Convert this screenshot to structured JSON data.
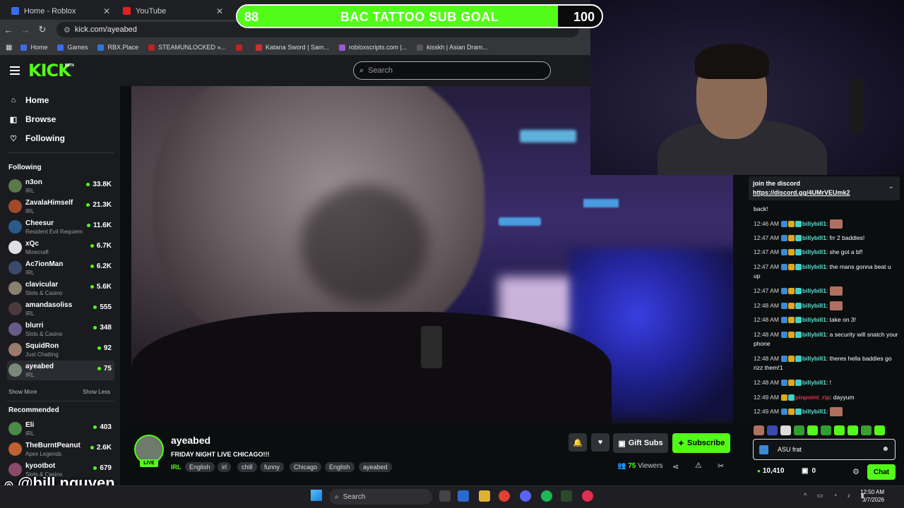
{
  "browser": {
    "tabs": [
      {
        "title": "Home - Roblox",
        "color": "#3b6ce8",
        "active": false
      },
      {
        "title": "YouTube",
        "color": "#e02020",
        "active": false
      }
    ],
    "url": "kick.com/ayeabed",
    "bookmarks": [
      {
        "label": "Home",
        "color": "#3b6ce8"
      },
      {
        "label": "Games",
        "color": "#3b6ce8"
      },
      {
        "label": "RBX.Place",
        "color": "#2a7ae0"
      },
      {
        "label": "STEAMUNLOCKED »...",
        "color": "#c02020"
      },
      {
        "label": "",
        "color": "#c02020"
      },
      {
        "label": "Katana Sword | Sam...",
        "color": "#d03030"
      },
      {
        "label": "robloxscripts.com |...",
        "color": "#9a5ad0"
      },
      {
        "label": "kisskh | Asian Dram...",
        "color": "#555"
      }
    ]
  },
  "sub_goal": {
    "current": "88",
    "target": "100",
    "title": "BAC TATTOO SUB GOAL",
    "progress": 0.88
  },
  "kick": {
    "logo": "KICK",
    "beta": "BETA",
    "search_placeholder": "Search"
  },
  "sidebar": {
    "nav": [
      {
        "label": "Home",
        "icon": "home-icon",
        "glyph": "⌂"
      },
      {
        "label": "Browse",
        "icon": "browse-icon",
        "glyph": "◧"
      },
      {
        "label": "Following",
        "icon": "heart-icon",
        "glyph": "♡"
      }
    ],
    "following_title": "Following",
    "following": [
      {
        "name": "n3on",
        "category": "IRL",
        "viewers": "33.8K",
        "color": "#5a7a4a"
      },
      {
        "name": "ZavalaHimself",
        "category": "IRL",
        "viewers": "21.3K",
        "color": "#a04a2a"
      },
      {
        "name": "Cheesur",
        "category": "Resident Evil Requiem",
        "viewers": "11.6K",
        "color": "#2a5a8a"
      },
      {
        "name": "xQc",
        "category": "Minecraft",
        "viewers": "6.7K",
        "color": "#e0e0e0"
      },
      {
        "name": "Ac7ionMan",
        "category": "IRL",
        "viewers": "6.2K",
        "color": "#3a4a6a"
      },
      {
        "name": "clavicular",
        "category": "Slots & Casino",
        "viewers": "5.6K",
        "color": "#8a8070"
      },
      {
        "name": "amandasoliss",
        "category": "IRL",
        "viewers": "555",
        "color": "#4a3a3a"
      },
      {
        "name": "blurri",
        "category": "Slots & Casino",
        "viewers": "348",
        "color": "#6a5a8a"
      },
      {
        "name": "SquidRon",
        "category": "Just Chatting",
        "viewers": "92",
        "color": "#9a7a6a"
      },
      {
        "name": "ayeabed",
        "category": "IRL",
        "viewers": "75",
        "color": "#7a8a7a",
        "selected": true
      }
    ],
    "show_more": "Show More",
    "show_less": "Show Less",
    "recommended_title": "Recommended",
    "recommended": [
      {
        "name": "Eli",
        "category": "IRL",
        "viewers": "403",
        "color": "#4a8a4a"
      },
      {
        "name": "TheBurntPeanut",
        "category": "Apex Legends",
        "viewers": "2.6K",
        "color": "#c06030"
      },
      {
        "name": "kyootbot",
        "category": "Slots & Casino",
        "viewers": "679",
        "color": "#8a4a6a"
      }
    ]
  },
  "stream": {
    "streamer": "ayeabed",
    "live_label": "LIVE",
    "title": "FRIDAY NIGHT LIVE CHICAGO!!!",
    "category": "IRL",
    "tags": [
      "English",
      "irl",
      "chill",
      "funny",
      "Chicago",
      "English",
      "ayeabed"
    ],
    "gift_subs_label": "Gift Subs",
    "subscribe_label": "Subscribe",
    "viewers_count": "75",
    "viewers_label": "Viewers"
  },
  "chat": {
    "pinned_title": "join the discord",
    "pinned_link": "https://discord.gg/4UMrVEUmk2",
    "partial_top": "back!",
    "messages": [
      {
        "time": "12:46 AM",
        "user": "billybill1",
        "text": "",
        "emote": true
      },
      {
        "time": "12:47 AM",
        "user": "billybill1",
        "text": "frr 2 baddies!",
        "emote": false
      },
      {
        "time": "12:47 AM",
        "user": "billybill1",
        "text": "she got a bf!",
        "emote": false
      },
      {
        "time": "12:47 AM",
        "user": "billybill1",
        "text": "the mans gonna beat u up",
        "emote": false
      },
      {
        "time": "12:47 AM",
        "user": "billybill1",
        "text": "",
        "emote": true
      },
      {
        "time": "12:48 AM",
        "user": "billybill1",
        "text": "",
        "emote": true
      },
      {
        "time": "12:48 AM",
        "user": "billybill1",
        "text": "take on 3!",
        "emote": false
      },
      {
        "time": "12:48 AM",
        "user": "billybill1",
        "text": "a security will snatch your phone",
        "emote": false
      },
      {
        "time": "12:48 AM",
        "user": "billybill1",
        "text": "theres hella baddies go rizz them!1",
        "emote": false
      },
      {
        "time": "12:48 AM",
        "user": "billybill1",
        "text": "!",
        "emote": false
      },
      {
        "time": "12:49 AM",
        "user": "pinpoint_rip",
        "text": "dayyum",
        "emote": false,
        "pink": true
      },
      {
        "time": "12:49 AM",
        "user": "billybill1",
        "text": "",
        "emote": true
      }
    ],
    "input_value": "ASU frat",
    "points": "10,410",
    "gifts": "0",
    "send_label": "Chat"
  },
  "watermark": "@bill.nguyen",
  "taskbar": {
    "search_placeholder": "Search",
    "time": "12:50 AM",
    "date": "3/7/2026"
  }
}
